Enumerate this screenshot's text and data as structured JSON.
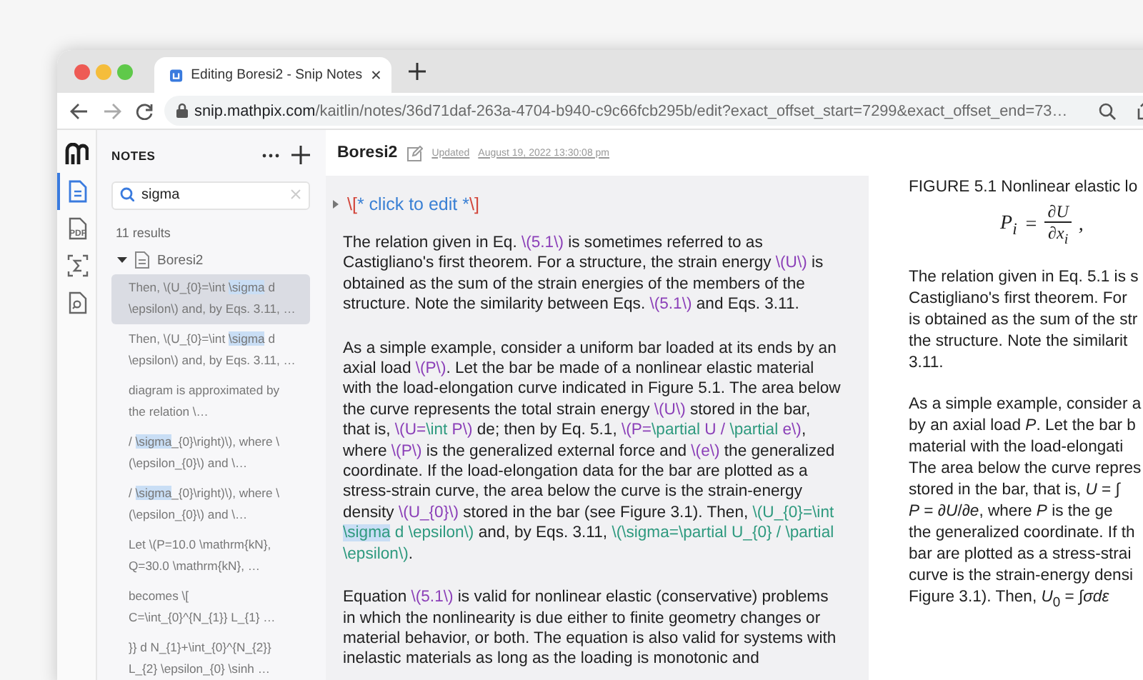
{
  "browser": {
    "tab": {
      "title": "Editing Boresi2 - Snip Notes"
    },
    "url": {
      "host": "snip.mathpix.com",
      "path": "/kaitlin/notes/36d71daf-263a-4704-b940-c9c66fcb295b/edit?exact_offset_start=7299&exact_offset_end=73…"
    }
  },
  "rail": {
    "items": [
      {
        "kind": "notes",
        "selected": true
      },
      {
        "kind": "pdf",
        "label": "PDF",
        "selected": false
      },
      {
        "kind": "formula",
        "selected": false
      },
      {
        "kind": "search-doc",
        "selected": false
      }
    ]
  },
  "notes_panel": {
    "title": "NOTES",
    "search": {
      "value": "sigma"
    },
    "result_count": "11 results",
    "folder": {
      "name": "Boresi2",
      "expanded": true
    },
    "results": [
      {
        "selected": true,
        "segments": [
          {
            "kind": "text",
            "text": "Then, \\(U_{0}=\\int "
          },
          {
            "kind": "match",
            "text": "\\sigma"
          },
          {
            "kind": "text",
            "text": " d\n\\epsilon\\) and, by Eqs. 3.11, …"
          }
        ]
      },
      {
        "selected": false,
        "segments": [
          {
            "kind": "text",
            "text": "Then, \\(U_{0}=\\int "
          },
          {
            "kind": "match",
            "text": "\\sigma"
          },
          {
            "kind": "text",
            "text": " d\n\\epsilon\\) and, by Eqs. 3.11, …"
          }
        ]
      },
      {
        "selected": false,
        "segments": [
          {
            "kind": "text",
            "text": "diagram is approximated by\nthe relation \\…"
          }
        ]
      },
      {
        "selected": false,
        "segments": [
          {
            "kind": "text",
            "text": "/ "
          },
          {
            "kind": "match",
            "text": "\\sigma"
          },
          {
            "kind": "text",
            "text": "_{0}\\right)\\), where \\\n(\\epsilon_{0}\\) and \\…"
          }
        ]
      },
      {
        "selected": false,
        "segments": [
          {
            "kind": "text",
            "text": "/ "
          },
          {
            "kind": "match",
            "text": "\\sigma"
          },
          {
            "kind": "text",
            "text": "_{0}\\right)\\), where \\\n(\\epsilon_{0}\\) and \\…"
          }
        ]
      },
      {
        "selected": false,
        "segments": [
          {
            "kind": "text",
            "text": "Let \\(P=10.0 \\mathrm{kN},\nQ=30.0 \\mathrm{kN}, …"
          }
        ]
      },
      {
        "selected": false,
        "segments": [
          {
            "kind": "text",
            "text": "becomes  \\[\nC=\\int_{0}^{N_{1}} L_{1} …"
          }
        ]
      },
      {
        "selected": false,
        "segments": [
          {
            "kind": "text",
            "text": "}} d N_{1}+\\int_{0}^{N_{2}}\nL_{2} \\epsilon_{0} \\sinh …"
          }
        ]
      }
    ]
  },
  "editor": {
    "title": "Boresi2",
    "updated_label": "Updated",
    "updated_date": "August 19, 2022 13:30:08 pm",
    "block": {
      "expanded": false,
      "segments": [
        {
          "kind": "delim",
          "text": "\\["
        },
        {
          "kind": "comment",
          "text": "* click to edit *"
        },
        {
          "kind": "delim",
          "text": "\\]"
        }
      ]
    },
    "paragraphs": [
      {
        "segments": [
          {
            "kind": "text",
            "text": "The relation given in Eq. "
          },
          {
            "kind": "math",
            "text": "\\(5.1\\)"
          },
          {
            "kind": "text",
            "text": " is sometimes referred to as\nCastigliano's first theorem. For a structure, the strain energy "
          },
          {
            "kind": "math",
            "text": "\\(U\\)"
          },
          {
            "kind": "text",
            "text": " is\nobtained as the sum of the strain energies of the members of the\nstructure. Note the similarity between Eqs. "
          },
          {
            "kind": "math",
            "text": "\\(5.1\\)"
          },
          {
            "kind": "text",
            "text": " and Eqs. 3.11."
          }
        ]
      },
      {
        "segments": [
          {
            "kind": "text",
            "text": "As a simple example, consider a uniform bar loaded at its ends by an\naxial load "
          },
          {
            "kind": "math",
            "text": "\\(P\\)"
          },
          {
            "kind": "text",
            "text": ". Let the bar be made of a nonlinear elastic material\nwith the load-elongation curve indicated in Figure 5.1. The area below\nthe curve represents the total strain energy "
          },
          {
            "kind": "math",
            "text": "\\(U\\)"
          },
          {
            "kind": "text",
            "text": " stored in the bar,\nthat is, "
          },
          {
            "kind": "math",
            "text": "\\(U="
          },
          {
            "kind": "command",
            "text": "\\int"
          },
          {
            "kind": "math",
            "text": " P\\)"
          },
          {
            "kind": "text",
            "text": " de; then by Eq. 5.1, "
          },
          {
            "kind": "math",
            "text": "\\(P="
          },
          {
            "kind": "command",
            "text": "\\partial"
          },
          {
            "kind": "math",
            "text": " U / "
          },
          {
            "kind": "command",
            "text": "\\partial"
          },
          {
            "kind": "math",
            "text": " e\\)"
          },
          {
            "kind": "text",
            "text": ",\nwhere "
          },
          {
            "kind": "math",
            "text": "\\(P\\)"
          },
          {
            "kind": "text",
            "text": " is the generalized external force and "
          },
          {
            "kind": "math",
            "text": "\\(e\\)"
          },
          {
            "kind": "text",
            "text": " the generalized\ncoordinate. If the load-elongation data for the bar are plotted as a\nstress-strain curve, the area below the curve is the strain-energy\ndensity "
          },
          {
            "kind": "math",
            "text": "\\(U_{0}\\)"
          },
          {
            "kind": "text",
            "text": " stored in the bar (see Figure 3.1). Then, "
          },
          {
            "kind": "command",
            "text": "\\(U_{0}=\\int\n"
          },
          {
            "kind": "match",
            "text": "\\sigma"
          },
          {
            "kind": "command",
            "text": " d \\epsilon\\)"
          },
          {
            "kind": "text",
            "text": " and, by Eqs. 3.11, "
          },
          {
            "kind": "command",
            "text": "\\(\\sigma=\\partial U_{0} / \\partial\n\\epsilon\\)"
          },
          {
            "kind": "text",
            "text": "."
          }
        ]
      },
      {
        "segments": [
          {
            "kind": "text",
            "text": "Equation "
          },
          {
            "kind": "math",
            "text": "\\(5.1\\)"
          },
          {
            "kind": "text",
            "text": " is valid for nonlinear elastic (conservative) problems\nin which the nonlinearity is due either to finite geometry changes or\nmaterial behavior, or both. The equation is also valid for systems with\ninelastic materials as long as the loading is monotonic and"
          }
        ]
      }
    ]
  },
  "preview": {
    "caption": "FIGURE 5.1 Nonlinear elastic lo",
    "equation": {
      "lhs": "P$_{i}$",
      "relation": "=",
      "numerator": "∂U",
      "denominator": "∂x$_{i}$",
      "trail": ","
    },
    "paragraphs": [
      {
        "lines": [
          "The relation given in Eq. 5.1 is s",
          "Castigliano's first theorem. For",
          "is obtained as the sum of the str",
          "the structure. Note the similarit",
          "3.11."
        ]
      },
      {
        "lines": [
          "As a simple example, consider a",
          "by an axial load *P*. Let the bar b",
          "material with the load-elongati",
          "The area below the curve repres",
          "stored in the bar, that is, *U* = ∫",
          "*P* = ∂*U*/∂*e*, where *P* is the ge",
          "the generalized coordinate. If th",
          "bar are plotted as a stress-strai",
          "curve is the strain-energy densi",
          "Figure 3.1). Then, *U*$_{0}$ = ∫*σdε*"
        ]
      }
    ]
  }
}
